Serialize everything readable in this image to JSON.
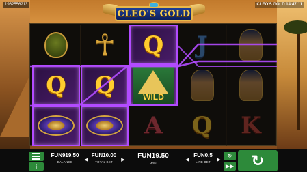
{
  "top_bar": {
    "session_id": "1962556213",
    "game_clock": "CLEO'S GOLD 14:47:11"
  },
  "logo": {
    "title": "CLEO'S GOLD"
  },
  "reels": {
    "rows": [
      [
        {
          "symbol": "scarab",
          "winning": false,
          "dim": false
        },
        {
          "symbol": "ankh",
          "winning": false,
          "dim": false
        },
        {
          "symbol": "Q",
          "winning": true,
          "dim": false
        },
        {
          "symbol": "J",
          "winning": false,
          "dim": true
        },
        {
          "symbol": "cleopatra",
          "winning": false,
          "dim": true
        }
      ],
      [
        {
          "symbol": "Q",
          "winning": true,
          "dim": false
        },
        {
          "symbol": "Q",
          "winning": true,
          "dim": false
        },
        {
          "symbol": "wild",
          "label": "WILD",
          "winning": true,
          "dim": false
        },
        {
          "symbol": "cleopatra",
          "winning": false,
          "dim": true
        },
        {
          "symbol": "cleopatra",
          "winning": false,
          "dim": true
        }
      ],
      [
        {
          "symbol": "eye-of-horus",
          "winning": true,
          "dim": false
        },
        {
          "symbol": "eye-of-horus",
          "winning": true,
          "dim": false
        },
        {
          "symbol": "A",
          "winning": false,
          "dim": true
        },
        {
          "symbol": "Q",
          "winning": false,
          "dim": true
        },
        {
          "symbol": "K",
          "winning": false,
          "dim": true
        }
      ]
    ]
  },
  "bottom_bar": {
    "balance_value": "FUN919.50",
    "balance_label": "BALANCE",
    "total_bet_value": "FUN10.00",
    "total_bet_label": "TOTAL BET",
    "win_value": "FUN19.50",
    "win_label": "WIN",
    "line_bet_value": "FUN0.5",
    "line_bet_label": "LINE BET",
    "info_label": "i",
    "bet_decrease": "◀",
    "bet_increase": "▶",
    "autoplay_label": "↻",
    "turbo_label": "▶▶",
    "spin_label": "↻"
  },
  "colors": {
    "accent_green": "#2d8a3a",
    "win_highlight": "#b24bff",
    "logo_gold": "#f4cf56"
  }
}
